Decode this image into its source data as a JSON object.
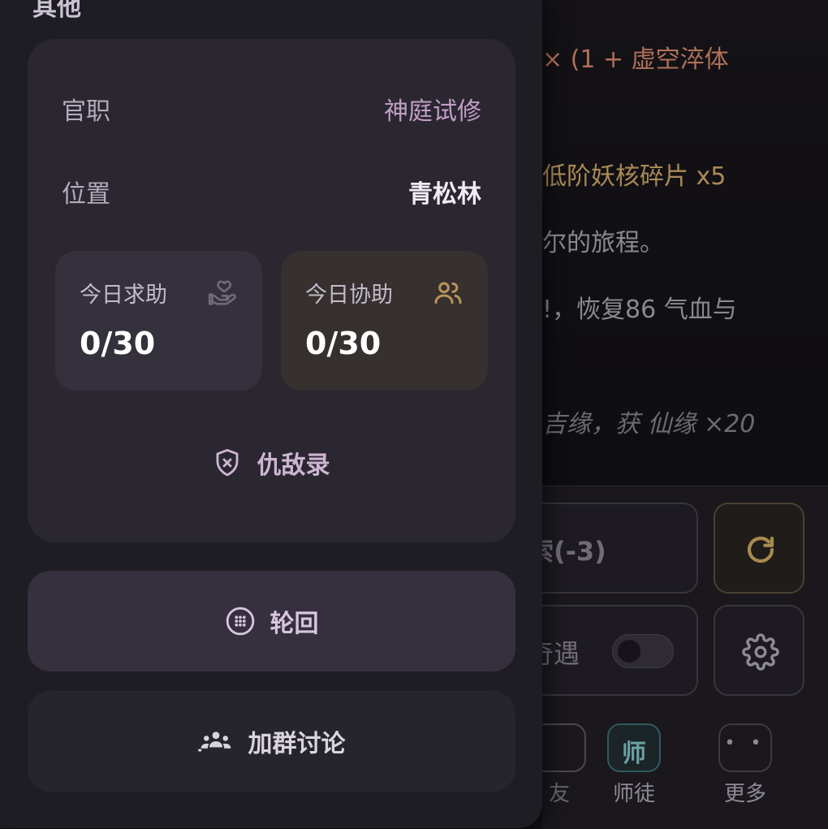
{
  "background": {
    "log_lines": [
      "× (1 + 虚空淬体",
      "低阶妖核碎片 x5",
      "尔的旅程。",
      "!，恢复86 气血与",
      "吉缘，获 仙缘 ×20"
    ],
    "explore_button_label": "索(-3)",
    "refresh_icon": "refresh-icon",
    "encounter_label": "奇遇",
    "encounter_toggle_on": false,
    "settings_icon": "gear-icon",
    "nav": {
      "hidden_label": "友",
      "master_glyph": "师",
      "master_label": "师徒",
      "more_glyph": "• •",
      "more_label": "更多"
    }
  },
  "drawer": {
    "heading": "其他",
    "info": {
      "office_key": "官职",
      "office_value": "神庭试修",
      "location_key": "位置",
      "location_value": "青松林"
    },
    "stats": {
      "help_label": "今日求助",
      "help_value": "0/30",
      "help_icon": "hand-heart-icon",
      "assist_label": "今日协助",
      "assist_value": "0/30",
      "assist_icon": "users-icon"
    },
    "enemy_label": "仇敌录",
    "enemy_icon": "shield-x-icon",
    "reincarnate_label": "轮回",
    "reincarnate_icon": "dots-circle-icon",
    "group_label": "加群讨论",
    "group_icon": "group-icon"
  },
  "colors": {
    "drawer_bg": "#1f1d24",
    "card_bg": "#2a2731",
    "accent_purple": "#c29ec6",
    "accent_gold": "#b8945a"
  }
}
